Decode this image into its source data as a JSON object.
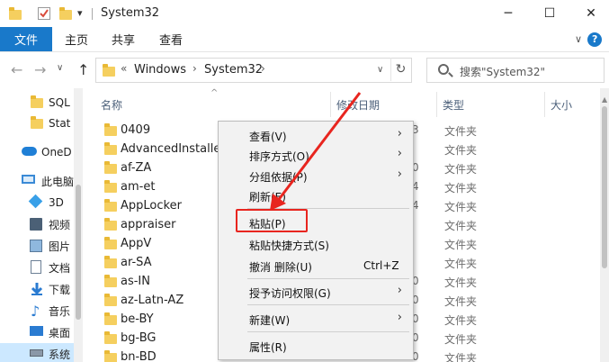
{
  "window": {
    "title": "System32",
    "minimize": "─",
    "maximize": "☐",
    "close": "✕",
    "dropdown": "▾"
  },
  "ribbon": {
    "tabs": [
      "文件",
      "主页",
      "共享",
      "查看"
    ],
    "expand": "∨",
    "help": "?"
  },
  "address": {
    "overflow": "«",
    "crumbs": [
      "Windows",
      "System32"
    ],
    "chevron": "›",
    "dropdown": "∨",
    "refresh": "↻",
    "back": "←",
    "forward": "→",
    "history": "∨",
    "up": "↑"
  },
  "search": {
    "placeholder": "搜索\"System32\""
  },
  "sidebar": {
    "items": [
      {
        "label": "SQL",
        "icon": "folder-icon"
      },
      {
        "label": "Stat",
        "icon": "folder-icon"
      },
      {
        "label": "OneD",
        "icon": "onedrive-icon"
      },
      {
        "label": "此电脑",
        "icon": "computer-icon"
      },
      {
        "label": "3D",
        "icon": "3d-objects-icon"
      },
      {
        "label": "视频",
        "icon": "video-icon"
      },
      {
        "label": "图片",
        "icon": "pictures-icon"
      },
      {
        "label": "文档",
        "icon": "documents-icon"
      },
      {
        "label": "下载",
        "icon": "download-icon"
      },
      {
        "label": "音乐",
        "icon": "music-icon"
      },
      {
        "label": "桌面",
        "icon": "desktop-icon"
      },
      {
        "label": "系统",
        "icon": "drive-icon"
      }
    ]
  },
  "columns": {
    "name": "名称",
    "date": "修改日期",
    "type": "类型",
    "size": "大小",
    "sort": "^"
  },
  "files": [
    {
      "name": "0409",
      "date": "3",
      "type": "文件夹"
    },
    {
      "name": "AdvancedInstallers",
      "date": "",
      "type": "文件夹"
    },
    {
      "name": "af-ZA",
      "date": "0",
      "type": "文件夹"
    },
    {
      "name": "am-et",
      "date": "4",
      "type": "文件夹"
    },
    {
      "name": "AppLocker",
      "date": "4",
      "type": "文件夹"
    },
    {
      "name": "appraiser",
      "date": "",
      "type": "文件夹"
    },
    {
      "name": "AppV",
      "date": "",
      "type": "文件夹"
    },
    {
      "name": "ar-SA",
      "date": "",
      "type": "文件夹"
    },
    {
      "name": "as-IN",
      "date": "0",
      "type": "文件夹"
    },
    {
      "name": "az-Latn-AZ",
      "date": "0",
      "type": "文件夹"
    },
    {
      "name": "be-BY",
      "date": "0",
      "type": "文件夹"
    },
    {
      "name": "bg-BG",
      "date": "0",
      "type": "文件夹"
    },
    {
      "name": "bn-BD",
      "date": "0",
      "type": "文件夹"
    }
  ],
  "context_menu": {
    "view": "查看(V)",
    "sort": "排序方式(O)",
    "group": "分组依据(P)",
    "refresh": "刷新(E)",
    "paste": "粘贴(P)",
    "paste_shortcut": "粘贴快捷方式(S)",
    "undo_delete": "撤消 删除(U)",
    "undo_shortcut": "Ctrl+Z",
    "grant_access": "授予访问权限(G)",
    "new": "新建(W)",
    "properties": "属性(R)",
    "submenu_arrow": "›"
  },
  "colors": {
    "accent": "#1979ca",
    "highlight": "#e8251f",
    "folder": "#f5cf5f",
    "selection": "#cce8ff"
  }
}
